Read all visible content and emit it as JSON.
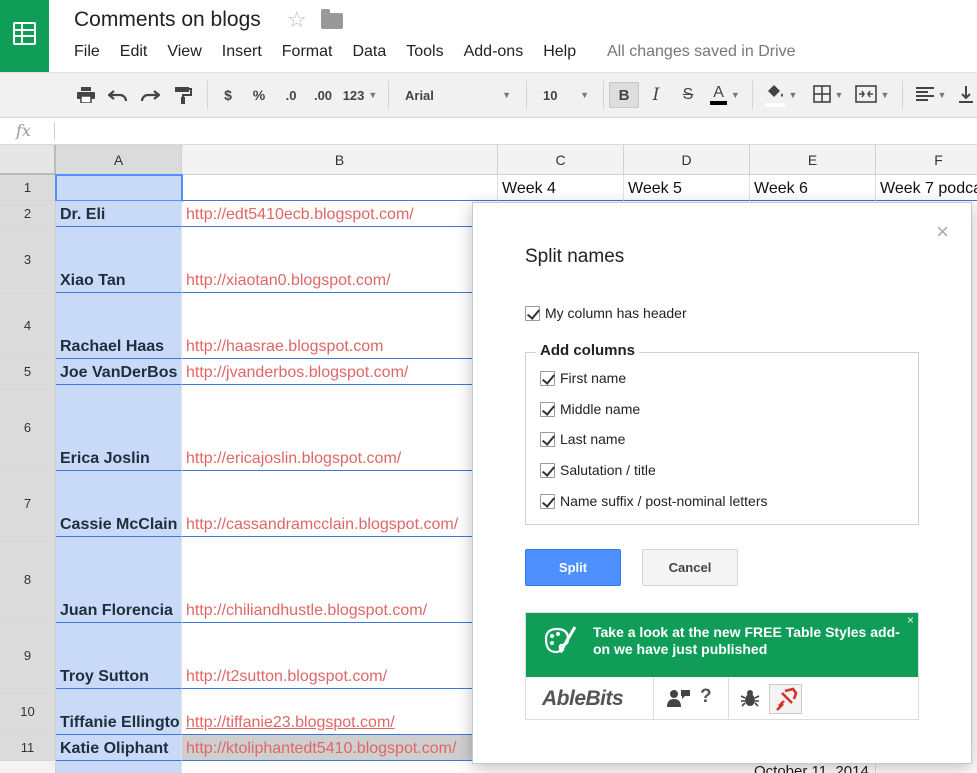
{
  "title": {
    "doc_title": "Comments on blogs",
    "save_status": "All changes saved in Drive"
  },
  "menu": [
    "File",
    "Edit",
    "View",
    "Insert",
    "Format",
    "Data",
    "Tools",
    "Add-ons",
    "Help"
  ],
  "toolbar": {
    "currency": "$",
    "percent": "%",
    "decrease_decimal": ".0",
    "increase_decimal": ".00",
    "more_formats": "123",
    "font": "Arial",
    "font_size": "10",
    "bold": "B",
    "italic": "I",
    "strike": "S",
    "text_color": "A"
  },
  "formula": {
    "fx": "fx"
  },
  "grid": {
    "columns": [
      "A",
      "B",
      "C",
      "D",
      "E",
      "F"
    ],
    "row_numbers": [
      "1",
      "2",
      "3",
      "4",
      "5",
      "6",
      "7",
      "8",
      "9",
      "10",
      "11"
    ],
    "header_row": [
      "",
      "",
      "Week 4",
      "Week 5",
      "Week 6",
      "Week 7 podca"
    ],
    "rows": [
      {
        "name": "Dr. Eli",
        "url": "http://edt5410ecb.blogspot.com/"
      },
      {
        "name": "Xiao Tan",
        "url": "http://xiaotan0.blogspot.com/"
      },
      {
        "name": "Rachael Haas",
        "url": "http://haasrae.blogspot.com"
      },
      {
        "name": "Joe VanDerBos",
        "url": "http://jvanderbos.blogspot.com/"
      },
      {
        "name": "Erica Joslin",
        "url": "http://ericajoslin.blogspot.com/"
      },
      {
        "name": "Cassie McClain",
        "url": "http://cassandramcclain.blogspot.com/"
      },
      {
        "name": "Juan Florencia",
        "url": "http://chiliandhustle.blogspot.com/"
      },
      {
        "name": "Troy Sutton",
        "url": "http://t2sutton.blogspot.com/"
      },
      {
        "name": "Tiffanie Ellingto",
        "url": "http://tiffanie23.blogspot.com/"
      },
      {
        "name": "Katie Oliphant",
        "url": "http://ktoliphantedt5410.blogspot.com/"
      }
    ],
    "partial_date": "October 11, 2014"
  },
  "dialog": {
    "title": "Split names",
    "close": "×",
    "header_option": "My column has header",
    "add_columns_label": "Add columns",
    "options": [
      "First name",
      "Middle name",
      "Last name",
      "Salutation / title",
      "Name suffix / post-nominal letters"
    ],
    "split_label": "Split",
    "cancel_label": "Cancel",
    "promo": {
      "text": "Take a look at the new FREE Table Styles add-on we have just published",
      "close": "×",
      "logo": "AbleBits",
      "help": "?"
    }
  },
  "colors": {
    "accent_green": "#0f9d58",
    "primary_blue": "#4d90fe",
    "link_red": "#e06666",
    "selection_blue": "#c9daf8"
  }
}
